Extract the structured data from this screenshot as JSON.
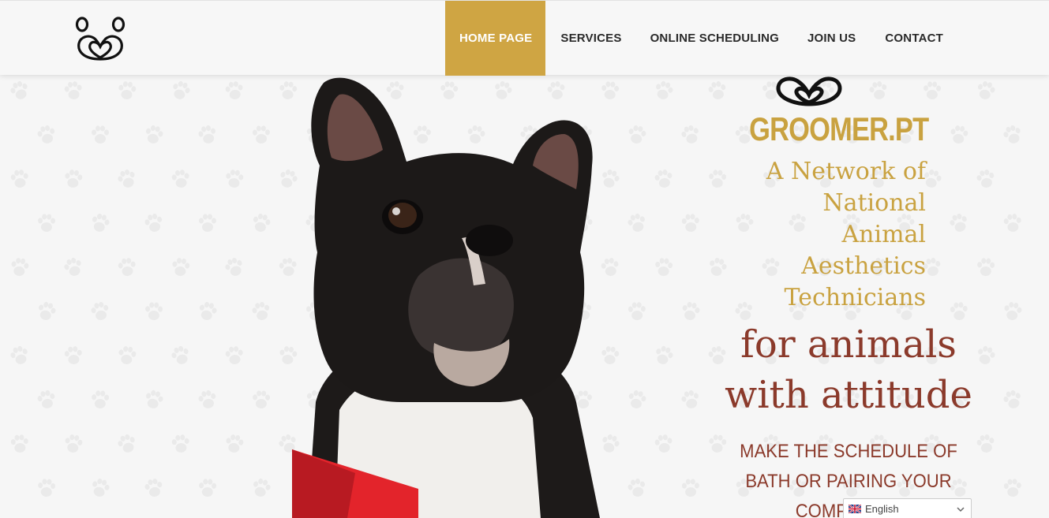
{
  "nav": {
    "items": [
      {
        "label": "HOME PAGE",
        "active": true
      },
      {
        "label": "SERVICES"
      },
      {
        "label": "ONLINE SCHEDULING"
      },
      {
        "label": "JOIN US"
      },
      {
        "label": "CONTACT"
      }
    ]
  },
  "hero": {
    "brand": "GROOMER.PT",
    "tagline_lines": [
      "A Network of",
      "National",
      "Animal",
      "Aesthetics",
      "Technicians"
    ],
    "headline_lines": [
      "for animals",
      "with attitude"
    ],
    "cta_lines": [
      "MAKE THE SCHEDULE OF",
      "BATH OR PAIRING YOUR",
      "COMPANION"
    ]
  },
  "language": {
    "selected": "English"
  },
  "colors": {
    "accent": "#cfa543",
    "brand_gold": "#c9a240",
    "headline_red": "#8b3a2b",
    "background": "#f6f6f6"
  },
  "icons": [
    "paw-logo-icon",
    "heart-loop-icon",
    "paw-print-icon",
    "uk-flag-icon",
    "chevron-down-icon"
  ]
}
